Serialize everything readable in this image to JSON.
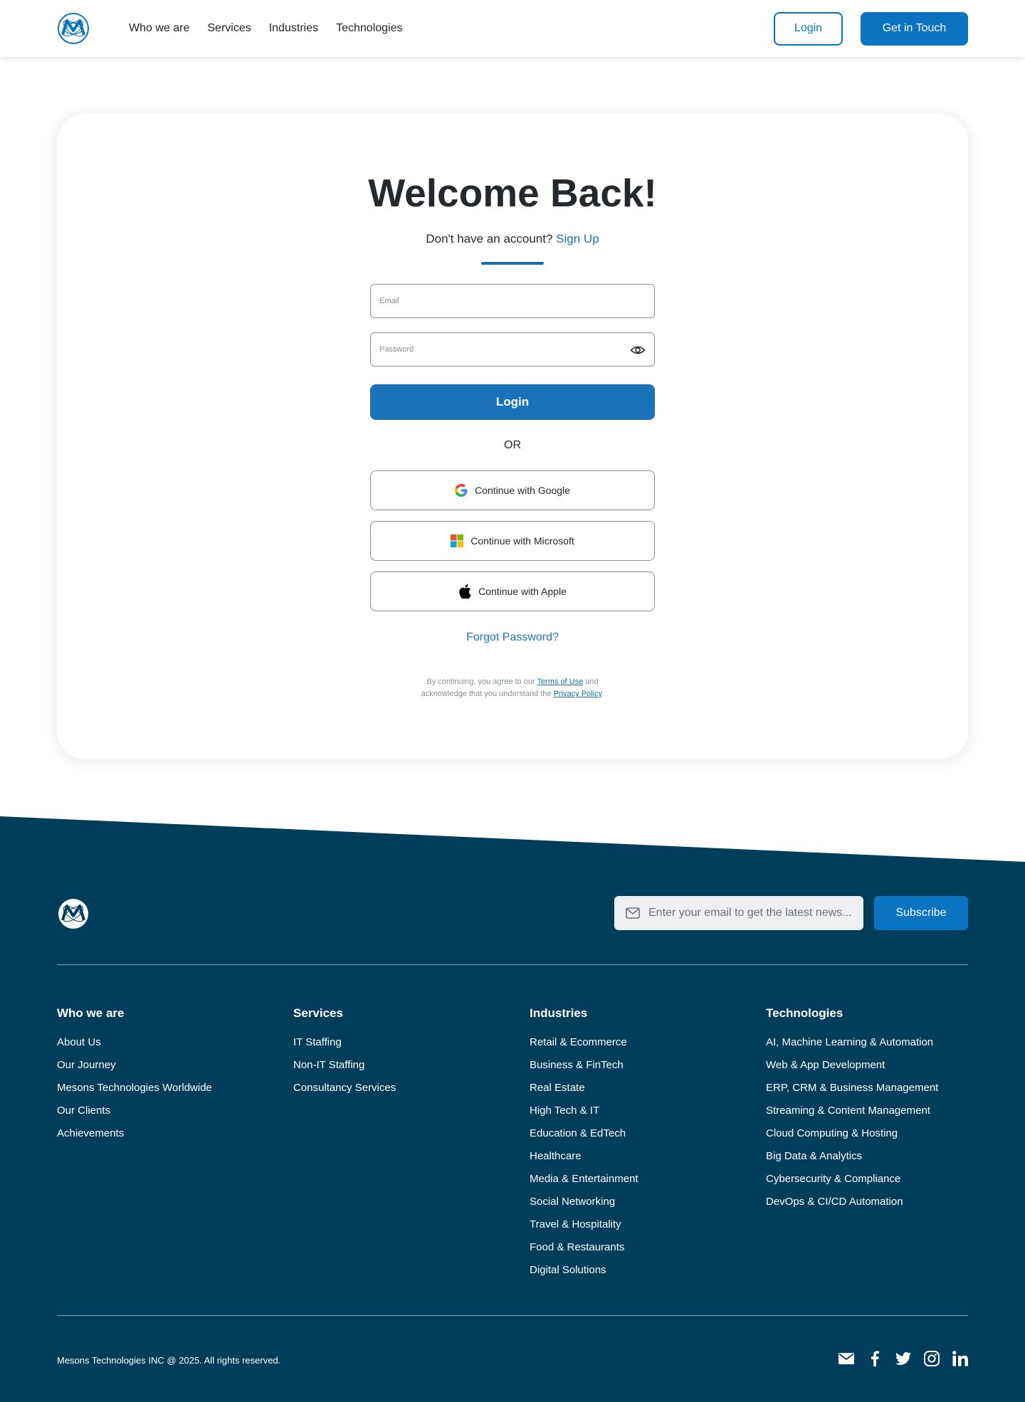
{
  "header": {
    "nav": [
      "Who we are",
      "Services",
      "Industries",
      "Technologies"
    ],
    "login_label": "Login",
    "contact_label": "Get in Touch"
  },
  "login_card": {
    "title": "Welcome Back!",
    "signup_prompt": "Don't have an account?",
    "signup_link": "Sign Up",
    "email_placeholder": "Email",
    "password_placeholder": "Password",
    "login_button": "Login",
    "or_label": "OR",
    "google_label": "Continue with Google",
    "microsoft_label": "Continue with Microsoft",
    "apple_label": "Continue with Apple",
    "forgot_password": "Forgot Password?",
    "legal_prefix": "By continuing, you agree to our",
    "terms_link": "Terms of Use",
    "legal_middle_1": "and",
    "legal_middle_2": "acknowledge that you understand the",
    "privacy_link": "Privacy Policy",
    "legal_suffix": "."
  },
  "footer": {
    "subscribe_placeholder": "Enter your email to get the latest news...",
    "subscribe_button": "Subscribe",
    "columns": [
      {
        "title": "Who we are",
        "links": [
          "About Us",
          "Our Journey",
          "Mesons Technologies Worldwide",
          "Our Clients",
          "Achievements"
        ]
      },
      {
        "title": "Services",
        "links": [
          "IT Staffing",
          "Non-IT Staffing",
          "Consultancy Services"
        ]
      },
      {
        "title": "Industries",
        "links": [
          "Retail & Ecommerce",
          "Business & FinTech",
          "Real Estate",
          "High Tech & IT",
          "Education & EdTech",
          "Healthcare",
          "Media & Entertainment",
          "Social Networking",
          "Travel & Hospitality",
          "Food & Restaurants",
          "Digital Solutions"
        ]
      },
      {
        "title": "Technologies",
        "links": [
          "AI, Machine Learning & Automation",
          "Web & App Development",
          "ERP, CRM & Business Management",
          "Streaming & Content Management",
          "Cloud Computing & Hosting",
          "Big Data & Analytics",
          "Cybersecurity & Compliance",
          "DevOps & CI/CD Automation"
        ]
      }
    ],
    "copyright": "Mesons Technologies INC @ 2025. All rights reserved.",
    "social_icons": [
      "mail-icon",
      "facebook-icon",
      "twitter-icon",
      "instagram-icon",
      "linkedin-icon"
    ]
  },
  "colors": {
    "primary": "#0a74c2",
    "footer_bg": "#003d5b",
    "text": "#24292e"
  }
}
